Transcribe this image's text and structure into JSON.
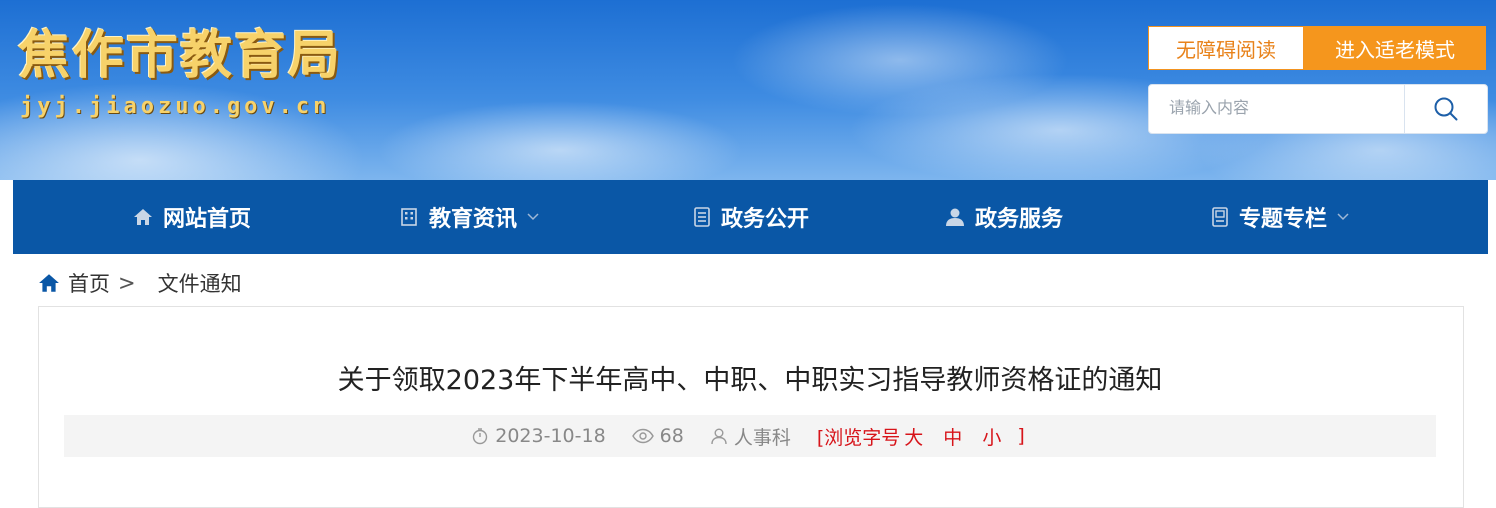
{
  "header": {
    "site_title": "焦作市教育局",
    "site_domain": "jyj.jiaozuo.gov.cn",
    "accessibility_label": "无障碍阅读",
    "elder_mode_label": "进入适老模式",
    "search_placeholder": "请输入内容",
    "search_icon": "search-icon"
  },
  "nav": {
    "items": [
      {
        "label": "网站首页",
        "icon": "home-icon"
      },
      {
        "label": "教育资讯",
        "icon": "building-icon",
        "has_dropdown": true
      },
      {
        "label": "政务公开",
        "icon": "document-icon"
      },
      {
        "label": "政务服务",
        "icon": "user-icon"
      },
      {
        "label": "专题专栏",
        "icon": "book-icon",
        "has_dropdown": true
      }
    ]
  },
  "breadcrumb": {
    "home": "首页",
    "separator": ">",
    "current": "文件通知"
  },
  "article": {
    "title": "关于领取2023年下半年高中、中职、中职实习指导教师资格证的通知",
    "date": "2023-10-18",
    "views": "68",
    "department": "人事科",
    "font_size": {
      "open": "[浏览字号",
      "large": "大",
      "medium": "中",
      "small": "小",
      "close": "]"
    }
  },
  "colors": {
    "nav_bg": "#0a57a6",
    "accent_orange": "#f5961d",
    "title_gold": "#f7d26a",
    "font_size_red": "#d7141a"
  }
}
